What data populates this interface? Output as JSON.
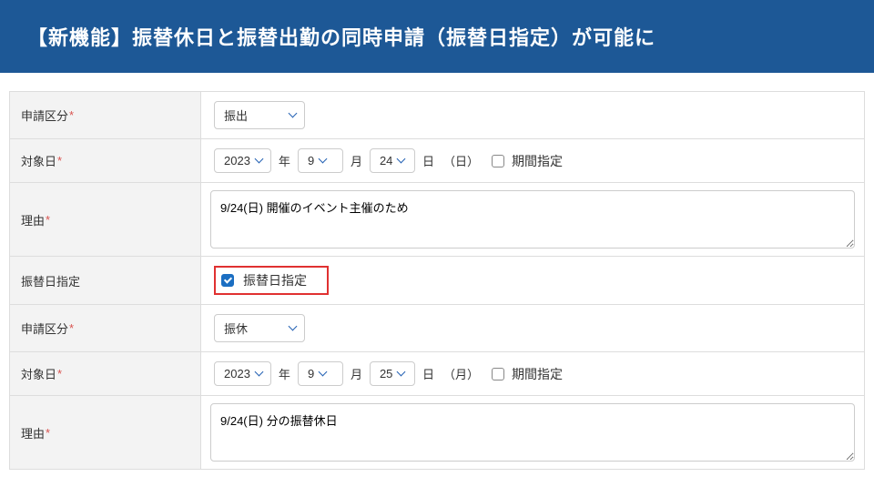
{
  "header": {
    "title": "【新機能】振替休日と振替出勤の同時申請（振替日指定）が可能に"
  },
  "labels": {
    "application_type": "申請区分",
    "target_date": "対象日",
    "reason": "理由",
    "substitute_date": "振替日指定",
    "year_suffix": "年",
    "month_suffix": "月",
    "day_suffix": "日",
    "period_spec": "期間指定"
  },
  "section1": {
    "type_value": "振出",
    "year": "2023",
    "month": "9",
    "day": "24",
    "weekday": "（日）",
    "reason_text": "9/24(日) 開催のイベント主催のため"
  },
  "substitute": {
    "checkbox_label": "振替日指定"
  },
  "section2": {
    "type_value": "振休",
    "year": "2023",
    "month": "9",
    "day": "25",
    "weekday": "（月）",
    "reason_text": "9/24(日) 分の振替休日"
  }
}
